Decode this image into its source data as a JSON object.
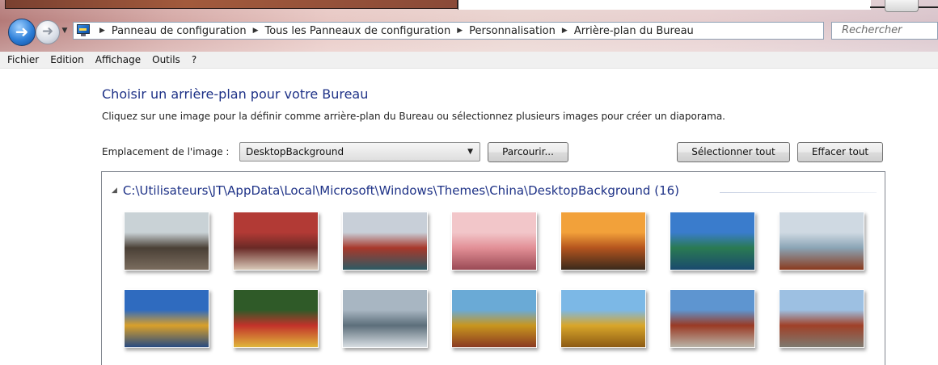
{
  "nav": {
    "breadcrumbs": [
      "Panneau de configuration",
      "Tous les Panneaux de configuration",
      "Personnalisation",
      "Arrière-plan du Bureau"
    ],
    "search_placeholder": "Rechercher",
    "icons": {
      "back": "back-arrow-icon",
      "forward": "forward-arrow-icon",
      "refresh": "refresh-icon",
      "control_panel": "control-panel-icon"
    }
  },
  "menu": {
    "items": [
      "Fichier",
      "Edition",
      "Affichage",
      "Outils",
      "?"
    ]
  },
  "content": {
    "heading": "Choisir un arrière-plan pour votre Bureau",
    "subtitle": "Cliquez sur une image pour la définir comme arrière-plan du Bureau ou sélectionnez plusieurs images pour créer un diaporama.",
    "location_label": "Emplacement de l'image :",
    "location_value": "DesktopBackground",
    "browse_label": "Parcourir...",
    "select_all_label": "Sélectionner tout",
    "clear_all_label": "Effacer tout"
  },
  "gallery": {
    "group_path": "C:\\Utilisateurs\\JT\\AppData\\Local\\Microsoft\\Windows\\Themes\\China\\DesktopBackground (16)",
    "thumbnails": [
      {
        "name": "houseboats-thumbnail",
        "colors": [
          "#c9d2d6",
          "#4a4036",
          "#7a6c5e"
        ]
      },
      {
        "name": "red-boat-thumbnail",
        "colors": [
          "#b23a35",
          "#6a2a26",
          "#d8c9b8"
        ]
      },
      {
        "name": "temple-of-heaven-thumbnail",
        "colors": [
          "#c8cfd8",
          "#a8382b",
          "#2c5a63"
        ]
      },
      {
        "name": "pink-reeds-thumbnail",
        "colors": [
          "#f2c6c9",
          "#e28f96",
          "#9a4a55"
        ]
      },
      {
        "name": "great-wall-sunset-thumbnail",
        "colors": [
          "#f2a13a",
          "#b4541e",
          "#3a2a1c"
        ]
      },
      {
        "name": "lake-pagoda-thumbnail",
        "colors": [
          "#3a7ccc",
          "#2a7a52",
          "#1a4a6e"
        ]
      },
      {
        "name": "junk-boat-thumbnail",
        "colors": [
          "#cfd9e2",
          "#8aa4b5",
          "#8a3a1e"
        ]
      },
      {
        "name": "golden-palace-thumbnail",
        "colors": [
          "#2f6bbf",
          "#d9a02a",
          "#274a82"
        ]
      },
      {
        "name": "lantern-thumbnail",
        "colors": [
          "#2f5a28",
          "#c2322a",
          "#e0b63a"
        ]
      },
      {
        "name": "harbor-skyline-thumbnail",
        "colors": [
          "#a8b6c2",
          "#5c6e7a",
          "#d8dee3"
        ]
      },
      {
        "name": "forbidden-city-roofs-thumbnail",
        "colors": [
          "#6aaad6",
          "#c8961e",
          "#8a3a22"
        ]
      },
      {
        "name": "roof-ornament-thumbnail",
        "colors": [
          "#7cb8e6",
          "#d8a62a",
          "#8c5a14"
        ]
      },
      {
        "name": "hall-of-harmony-thumbnail",
        "colors": [
          "#5e95d0",
          "#9a3a24",
          "#b9b4a8"
        ]
      },
      {
        "name": "palace-courtyard-thumbnail",
        "colors": [
          "#9dc0e2",
          "#a04028",
          "#7e7a70"
        ]
      }
    ]
  }
}
